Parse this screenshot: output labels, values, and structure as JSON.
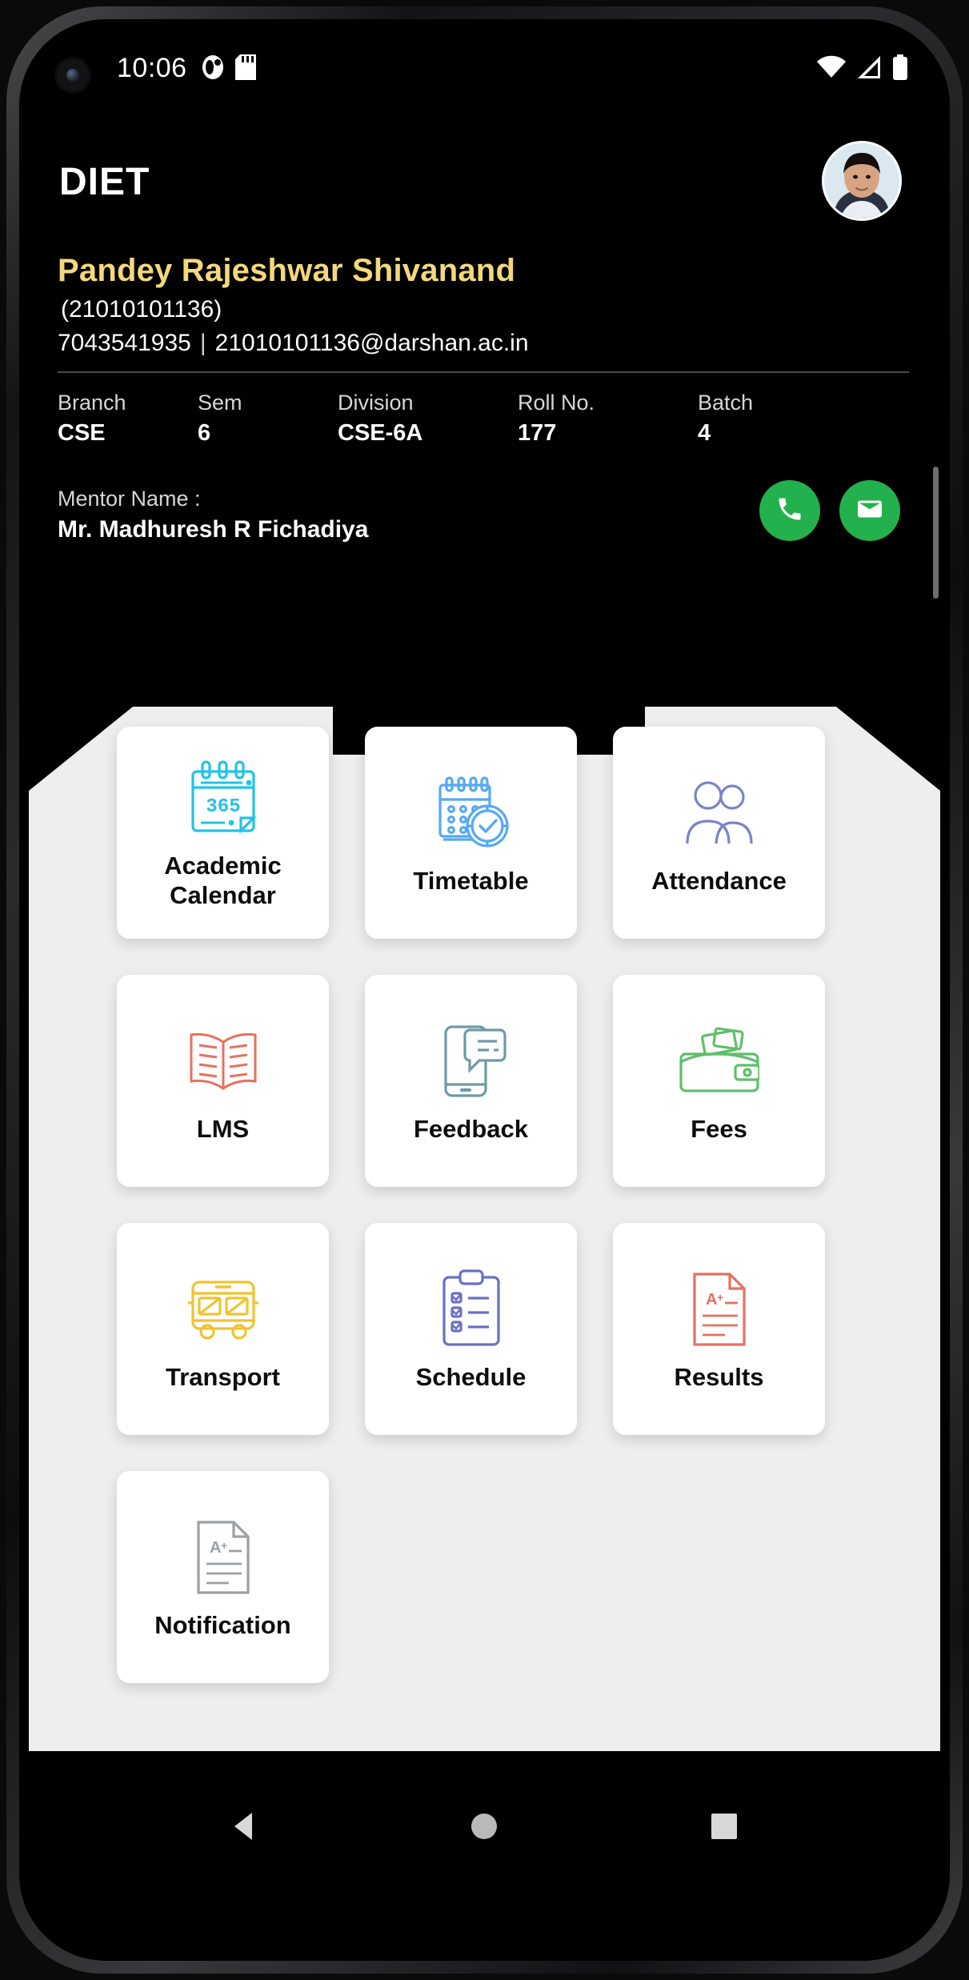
{
  "statusbar": {
    "time": "10:06",
    "icons_left": [
      "do-not-disturb-icon",
      "sd-card-icon"
    ],
    "icons_right": [
      "wifi-icon",
      "cellular-signal-icon",
      "battery-icon"
    ]
  },
  "header": {
    "app_title": "DIET",
    "avatar_alt": "student-photo",
    "student_name": "Pandey Rajeshwar Shivanand",
    "enrollment": "(21010101136)",
    "phone": "7043541935",
    "separator": "|",
    "email": "21010101136@darshan.ac.in",
    "info": [
      {
        "label": "Branch",
        "value": "CSE"
      },
      {
        "label": "Sem",
        "value": "6"
      },
      {
        "label": "Division",
        "value": "CSE-6A"
      },
      {
        "label": "Roll No.",
        "value": "177"
      },
      {
        "label": "Batch",
        "value": "4"
      }
    ],
    "mentor_label": "Mentor Name :",
    "mentor_name": "Mr. Madhuresh R Fichadiya",
    "call_button": "call-icon",
    "email_button": "email-icon",
    "accent_yellow": "#F3D87C",
    "action_green": "#22B14C"
  },
  "grid": {
    "tiles": [
      {
        "label": "Academic\nCalendar",
        "icon": "calendar-365-icon",
        "color": "#22C3E6"
      },
      {
        "label": "Timetable",
        "icon": "calendar-clock-icon",
        "color": "#56A8F5"
      },
      {
        "label": "Attendance",
        "icon": "people-group-icon",
        "color": "#7B83C9"
      },
      {
        "label": "LMS",
        "icon": "open-book-icon",
        "color": "#E8705F"
      },
      {
        "label": "Feedback",
        "icon": "phone-chat-icon",
        "color": "#6E9AA6"
      },
      {
        "label": "Fees",
        "icon": "wallet-money-icon",
        "color": "#5FBF6A"
      },
      {
        "label": "Transport",
        "icon": "bus-icon",
        "color": "#F0C330"
      },
      {
        "label": "Schedule",
        "icon": "clipboard-checklist-icon",
        "color": "#6C6FC4"
      },
      {
        "label": "Results",
        "icon": "result-document-icon",
        "color": "#E8705F"
      },
      {
        "label": "Notification",
        "icon": "notification-document-icon",
        "color": "#9AA0A6"
      }
    ]
  },
  "navbar": {
    "back": "back-triangle-icon",
    "home": "home-circle-icon",
    "recents": "recents-square-icon"
  }
}
